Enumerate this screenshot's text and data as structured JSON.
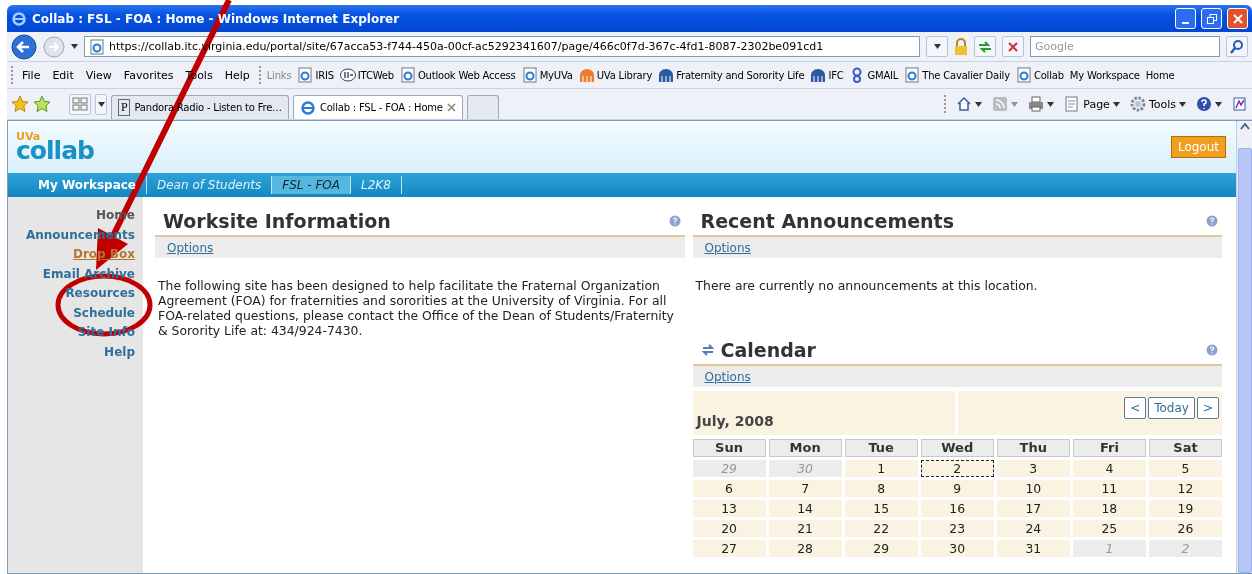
{
  "window": {
    "title": "Collab : FSL - FOA : Home - Windows Internet Explorer"
  },
  "address": {
    "url": "https://collab.itc.virginia.edu/portal/site/67acca53-f744-450a-00cf-ac5292341607/page/466c0f7d-367c-4fd1-8087-2302be091cd1"
  },
  "search": {
    "placeholder": "Google"
  },
  "menu": [
    "File",
    "Edit",
    "View",
    "Favorites",
    "Tools",
    "Help"
  ],
  "links_label": "Links",
  "links": [
    {
      "label": "IRIS",
      "kind": "page"
    },
    {
      "label": "ITCWeb",
      "kind": "itc"
    },
    {
      "label": "Outlook Web Access",
      "kind": "page"
    },
    {
      "label": "MyUVa",
      "kind": "page"
    },
    {
      "label": "UVa Library",
      "kind": "dome"
    },
    {
      "label": "Fraternity and Sorority Life",
      "kind": "building"
    },
    {
      "label": "IFC",
      "kind": "building"
    },
    {
      "label": "GMAIL",
      "kind": "google"
    },
    {
      "label": "The Cavalier Daily",
      "kind": "page"
    },
    {
      "label": "Collab",
      "kind": "page"
    },
    {
      "label": "My Workspace",
      "kind": "plain"
    },
    {
      "label": "Home",
      "kind": "plain"
    }
  ],
  "tabs": [
    {
      "label": "Pandora Radio - Listen to Fre…",
      "kind": "letter",
      "icon_letter": "P",
      "selected": false
    },
    {
      "label": "Collab : FSL - FOA : Home",
      "kind": "page",
      "selected": true
    }
  ],
  "commands": [
    {
      "kind": "home",
      "disabled": false
    },
    {
      "kind": "feed",
      "disabled": true
    },
    {
      "kind": "print",
      "disabled": false
    },
    {
      "kind": "page",
      "label": "Page",
      "disabled": false
    },
    {
      "kind": "tools",
      "label": "Tools",
      "disabled": false
    },
    {
      "kind": "help",
      "disabled": false
    },
    {
      "kind": "research",
      "disabled": false
    }
  ],
  "site": {
    "logo_badge": "UVa",
    "logo_name": "collab",
    "logout": "Logout"
  },
  "site_tabs": [
    {
      "label": "My Workspace",
      "selected": false,
      "italic": false
    },
    {
      "label": "Dean of Students",
      "selected": false,
      "italic": true
    },
    {
      "label": "FSL - FOA",
      "selected": true,
      "italic": true
    },
    {
      "label": "L2K8",
      "selected": false,
      "italic": true
    }
  ],
  "tools": [
    {
      "label": "Home",
      "selected": true,
      "hovered": false
    },
    {
      "label": "Announcements",
      "selected": false,
      "hovered": false
    },
    {
      "label": "Drop Box",
      "selected": false,
      "hovered": true
    },
    {
      "label": "Email Archive",
      "selected": false,
      "hovered": false
    },
    {
      "label": "Resources",
      "selected": false,
      "hovered": false
    },
    {
      "label": "Schedule",
      "selected": false,
      "hovered": false
    },
    {
      "label": "Site Info",
      "selected": false,
      "hovered": false
    },
    {
      "label": "Help",
      "selected": false,
      "hovered": false
    }
  ],
  "worksite": {
    "title": "Worksite Information",
    "options": "Options",
    "text": "The following site has been designed to help facilitate the Fraternal Organization Agreement (FOA) for fraternities and sororities at the University of Virginia. For all FOA-related questions, please contact the Office of the Dean of Students/Fraternity & Sorority Life at: 434/924-7430."
  },
  "announcements": {
    "title": "Recent Announcements",
    "options": "Options",
    "text": "There are currently no announcements at this location."
  },
  "calendar": {
    "title": "Calendar",
    "options": "Options",
    "month": "July, 2008",
    "buttons": [
      "<",
      "Today",
      ">"
    ],
    "days": [
      "Sun",
      "Mon",
      "Tue",
      "Wed",
      "Thu",
      "Fri",
      "Sat"
    ],
    "weeks": [
      [
        {
          "d": "29",
          "muted": true,
          "focused": false
        },
        {
          "d": "30",
          "muted": true,
          "focused": false
        },
        {
          "d": "1",
          "muted": false,
          "focused": false
        },
        {
          "d": "2",
          "muted": false,
          "focused": true
        },
        {
          "d": "3",
          "muted": false,
          "focused": false
        },
        {
          "d": "4",
          "muted": false,
          "focused": false
        },
        {
          "d": "5",
          "muted": false,
          "focused": false
        }
      ],
      [
        {
          "d": "6",
          "muted": false,
          "focused": false
        },
        {
          "d": "7",
          "muted": false,
          "focused": false
        },
        {
          "d": "8",
          "muted": false,
          "focused": false
        },
        {
          "d": "9",
          "muted": false,
          "focused": false
        },
        {
          "d": "10",
          "muted": false,
          "focused": false
        },
        {
          "d": "11",
          "muted": false,
          "focused": false
        },
        {
          "d": "12",
          "muted": false,
          "focused": false
        }
      ],
      [
        {
          "d": "13",
          "muted": false,
          "focused": false
        },
        {
          "d": "14",
          "muted": false,
          "focused": false
        },
        {
          "d": "15",
          "muted": false,
          "focused": false
        },
        {
          "d": "16",
          "muted": false,
          "focused": false
        },
        {
          "d": "17",
          "muted": false,
          "focused": false
        },
        {
          "d": "18",
          "muted": false,
          "focused": false
        },
        {
          "d": "19",
          "muted": false,
          "focused": false
        }
      ],
      [
        {
          "d": "20",
          "muted": false,
          "focused": false
        },
        {
          "d": "21",
          "muted": false,
          "focused": false
        },
        {
          "d": "22",
          "muted": false,
          "focused": false
        },
        {
          "d": "23",
          "muted": false,
          "focused": false
        },
        {
          "d": "24",
          "muted": false,
          "focused": false
        },
        {
          "d": "25",
          "muted": false,
          "focused": false
        },
        {
          "d": "26",
          "muted": false,
          "focused": false
        }
      ],
      [
        {
          "d": "27",
          "muted": false,
          "focused": false
        },
        {
          "d": "28",
          "muted": false,
          "focused": false
        },
        {
          "d": "29",
          "muted": false,
          "focused": false
        },
        {
          "d": "30",
          "muted": false,
          "focused": false
        },
        {
          "d": "31",
          "muted": false,
          "focused": false
        },
        {
          "d": "1",
          "muted": true,
          "focused": false
        },
        {
          "d": "2",
          "muted": true,
          "focused": false
        }
      ]
    ]
  },
  "annotation": {
    "arrow": true,
    "circle": true
  }
}
